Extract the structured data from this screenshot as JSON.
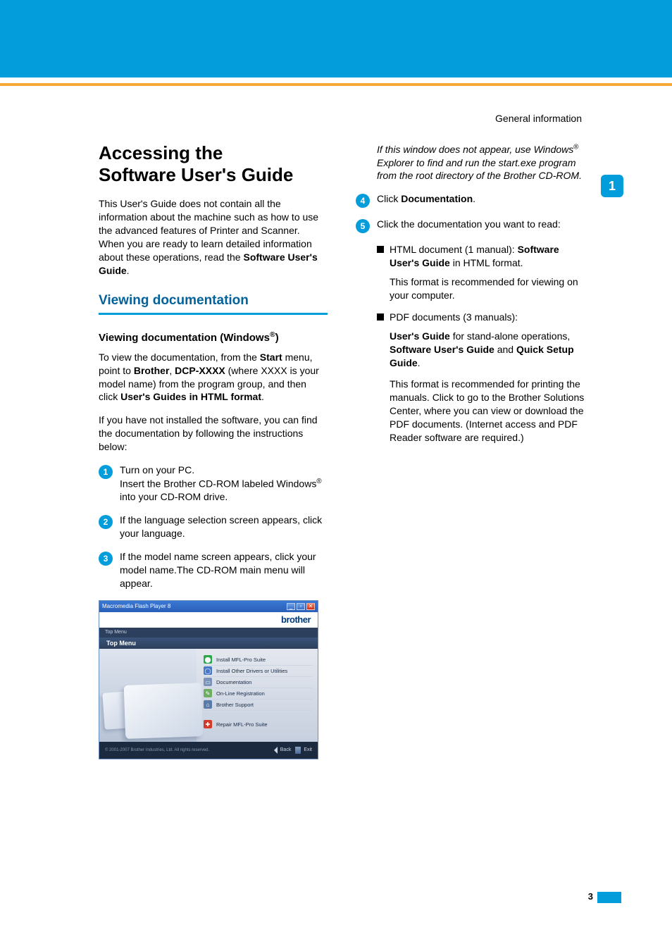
{
  "header_right": "General information",
  "right_tab": "1",
  "col1": {
    "h1_a": "Accessing the",
    "h1_b": "Software User's Guide",
    "intro": "This User's Guide does not contain all the information about the machine such as how to use the advanced features of Printer and Scanner. When you are ready to learn detailed information about these operations, read the ",
    "intro_bold": "Software User's Guide",
    "intro_end": ".",
    "h2": "Viewing documentation",
    "h3_prefix": "Viewing documentation (Windows",
    "h3_sup": "®",
    "h3_suffix": ")",
    "p2_a": "To view the documentation, from the ",
    "p2_b": "Start",
    "p2_c": " menu, point to ",
    "p2_d": "Brother",
    "p2_e": ", ",
    "p2_f": "DCP-XXXX",
    "p2_g": " (where XXXX is your model name) from the program group, and then click ",
    "p2_h": "User's Guides in HTML format",
    "p2_i": ".",
    "p3": "If you have not installed the software, you can find the documentation by following the instructions below:",
    "steps": {
      "s1_a": "Turn on your PC.",
      "s1_b1": "Insert the Brother CD-ROM labeled Windows",
      "s1_b_sup": "®",
      "s1_b2": " into your CD-ROM drive.",
      "s2": "If the language selection screen appears, click your language.",
      "s3": "If the model name screen appears, click your model name.The CD-ROM main menu will appear."
    }
  },
  "col2": {
    "note_a": "If this window does not appear, use Windows",
    "note_sup": "®",
    "note_b": " Explorer to find and run the start.exe program from the root directory of the Brother CD-ROM.",
    "s4_a": "Click ",
    "s4_b": "Documentation",
    "s4_c": ".",
    "s5": "Click the documentation you want to read:",
    "b1_a": "HTML document (1 manual): ",
    "b1_b": "Software User's Guide",
    "b1_c": " in HTML format.",
    "b1_sub": "This format is recommended for viewing on your computer.",
    "b2": "PDF documents (3 manuals):",
    "b2_sub_a": "User's Guide",
    "b2_sub_b": " for stand-alone operations, ",
    "b2_sub_c": "Software User's Guide",
    "b2_sub_d": " and ",
    "b2_sub_e": "Quick Setup Guide",
    "b2_sub_f": ".",
    "b2_sub2": "This format is recommended for printing the manuals. Click to go to the Brother Solutions Center, where you can view or download the PDF documents. (Internet access and PDF Reader software are required.)"
  },
  "installer": {
    "title": "Macromedia Flash Player 8",
    "brand": "brother",
    "topmenu_tab": "Top Menu",
    "topmenu": "Top Menu",
    "items": [
      {
        "icon_bg": "#2aa84a",
        "icon": "⬤",
        "label": "Install MFL-Pro Suite"
      },
      {
        "icon_bg": "#4a79c7",
        "icon": "◯",
        "label": "Install Other Drivers or Utilities"
      },
      {
        "icon_bg": "#7a93b8",
        "icon": "▭",
        "label": "Documentation"
      },
      {
        "icon_bg": "#6fae62",
        "icon": "✎",
        "label": "On-Line Registration"
      },
      {
        "icon_bg": "#5a7aa8",
        "icon": "⌂",
        "label": "Brother Support"
      }
    ],
    "repair": {
      "icon_bg": "#d23a2a",
      "icon": "✚",
      "label": "Repair MFL-Pro Suite"
    },
    "copyright": "© 2001-2007 Brother Industries, Ltd. All rights reserved.",
    "back": "Back",
    "exit": "Exit"
  },
  "page_number": "3"
}
